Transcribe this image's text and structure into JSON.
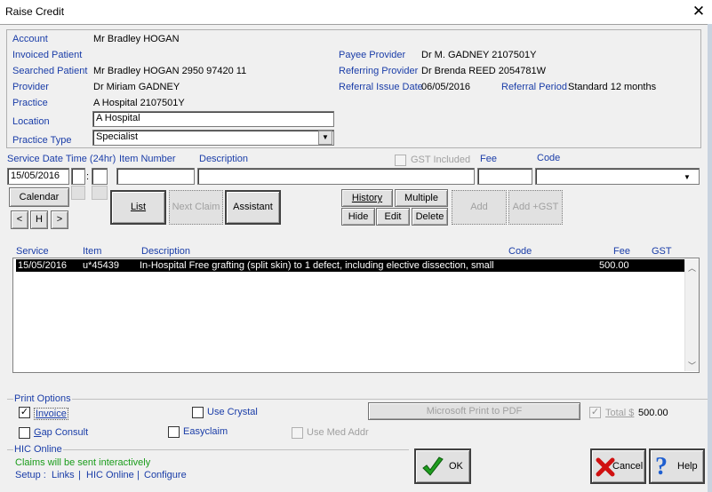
{
  "window": {
    "title": "Raise Credit"
  },
  "header": {
    "account_label": "Account",
    "account_value": "Mr Bradley HOGAN",
    "invoiced_patient_label": "Invoiced Patient",
    "searched_patient_label": "Searched Patient",
    "searched_patient_value": "Mr Bradley HOGAN 2950 97420 11",
    "provider_label": "Provider",
    "provider_value": "Dr Miriam GADNEY",
    "practice_label": "Practice",
    "practice_value": "A Hospital 2107501Y",
    "location_label": "Location",
    "location_value": "A Hospital",
    "practice_type_label": "Practice Type",
    "practice_type_value": "Specialist",
    "payee_provider_label": "Payee Provider",
    "payee_provider_value": "Dr M. GADNEY 2107501Y",
    "referring_provider_label": "Referring Provider",
    "referring_provider_value": "Dr Brenda REED 2054781W",
    "referral_issue_date_label": "Referral Issue Date",
    "referral_issue_date_value": "06/05/2016",
    "referral_period_label": "Referral Period",
    "referral_period_value": "Standard 12 months"
  },
  "entry": {
    "service_date_label": "Service Date Time (24hr)",
    "service_date_value": "15/05/2016",
    "time_sep": ":",
    "item_number_label": "Item Number",
    "description_label": "Description",
    "gst_included_label": "GST Included",
    "fee_label": "Fee",
    "code_label": "Code",
    "calendar_label": "Calendar",
    "prev_label": "<",
    "h_label": "H",
    "next_label": ">",
    "list_label": "List",
    "next_claim_label": "Next Claim",
    "assistant_label": "Assistant",
    "history_label": "History",
    "multiple_label": "Multiple",
    "hide_label": "Hide",
    "edit_label": "Edit",
    "delete_label": "Delete",
    "add_label": "Add",
    "add_gst_label": "Add +GST"
  },
  "table": {
    "columns": [
      "Service",
      "Item",
      "Description",
      "Code",
      "Fee",
      "GST"
    ],
    "rows": [
      {
        "service": "15/05/2016",
        "item": "u*45439",
        "description": "In-Hospital Free grafting (split skin) to 1 defect, including  elective dissection, small",
        "code": "",
        "fee": "500.00",
        "gst": ""
      }
    ]
  },
  "print_options": {
    "label": "Print Options",
    "invoice_label": "Invoice",
    "invoice_checked": "✓",
    "use_crystal_label": "Use Crystal",
    "printer_value": "Microsoft Print to PDF",
    "total_label": "Total $",
    "total_checked": "✓",
    "total_value": "500.00",
    "gap_consult_label": "Gap Consult",
    "easyclaim_label": "Easyclaim",
    "use_med_addr_label": "Use Med Addr"
  },
  "hic": {
    "label": "HIC Online",
    "status": "Claims will be sent interactively",
    "setup_label": "Setup :",
    "links_label": "Links",
    "sep": "|",
    "hic_online_link": "HIC Online",
    "configure_label": "Configure"
  },
  "footer": {
    "ok_label": "OK",
    "cancel_label": "Cancel",
    "help_label": "Help"
  },
  "colors": {
    "label_blue": "#1a3da8",
    "status_green": "#1a9c1a",
    "ok_green": "#1f9d1f",
    "cancel_red": "#d01010",
    "help_blue": "#1f5fd0"
  }
}
